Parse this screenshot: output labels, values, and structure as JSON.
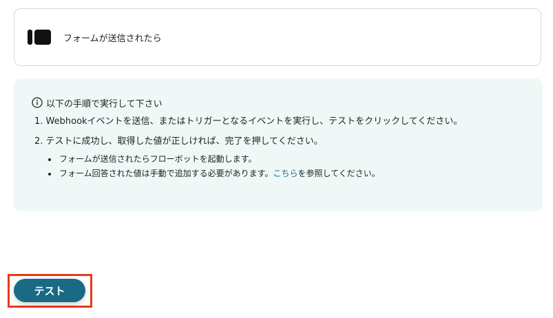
{
  "trigger": {
    "icon": "form-icon",
    "label": "フォームが送信されたら"
  },
  "info": {
    "icon": "info-icon",
    "heading": "以下の手順で実行して下さい",
    "steps": [
      "1. Webhookイベントを送信、またはトリガーとなるイベントを実行し、テストをクリックしてください。",
      "2. テストに成功し、取得した値が正しければ、完了を押してください。"
    ],
    "bullets": {
      "first": "フォームが送信されたらフローボットを起動します。",
      "second_before": "フォーム回答された値は手動で追加する必要があります。",
      "second_link": "こちら",
      "second_after": "を参照してください。"
    },
    "link_color": "#1a6a8a"
  },
  "actions": {
    "test_label": "テスト",
    "button_color": "#1b6a85",
    "highlight_color": "#e8391c"
  }
}
